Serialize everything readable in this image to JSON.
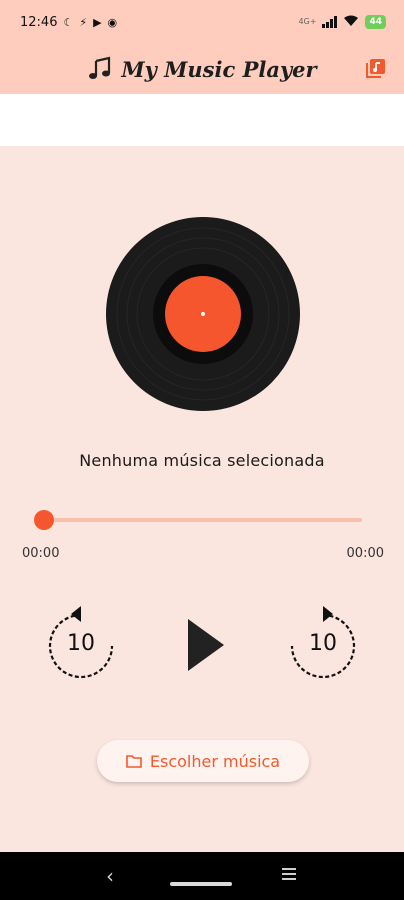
{
  "status_bar": {
    "time": "12:46",
    "network": "4G+",
    "battery": "44"
  },
  "header": {
    "title": "My Music Player",
    "icons": {
      "title": "music-note-icon",
      "action": "playlist-icon"
    }
  },
  "player": {
    "track_title": "Nenhuma música selecionada",
    "current_time": "00:00",
    "total_time": "00:00",
    "progress": 0,
    "rewind_seconds": "10",
    "forward_seconds": "10"
  },
  "actions": {
    "choose_label": "Escolher música",
    "choose_icon": "folder-icon"
  },
  "colors": {
    "accent": "#f5562d",
    "header_bg": "#ffcdbd",
    "page_bg": "#fbe5df",
    "track_bg": "#f8bfae"
  }
}
